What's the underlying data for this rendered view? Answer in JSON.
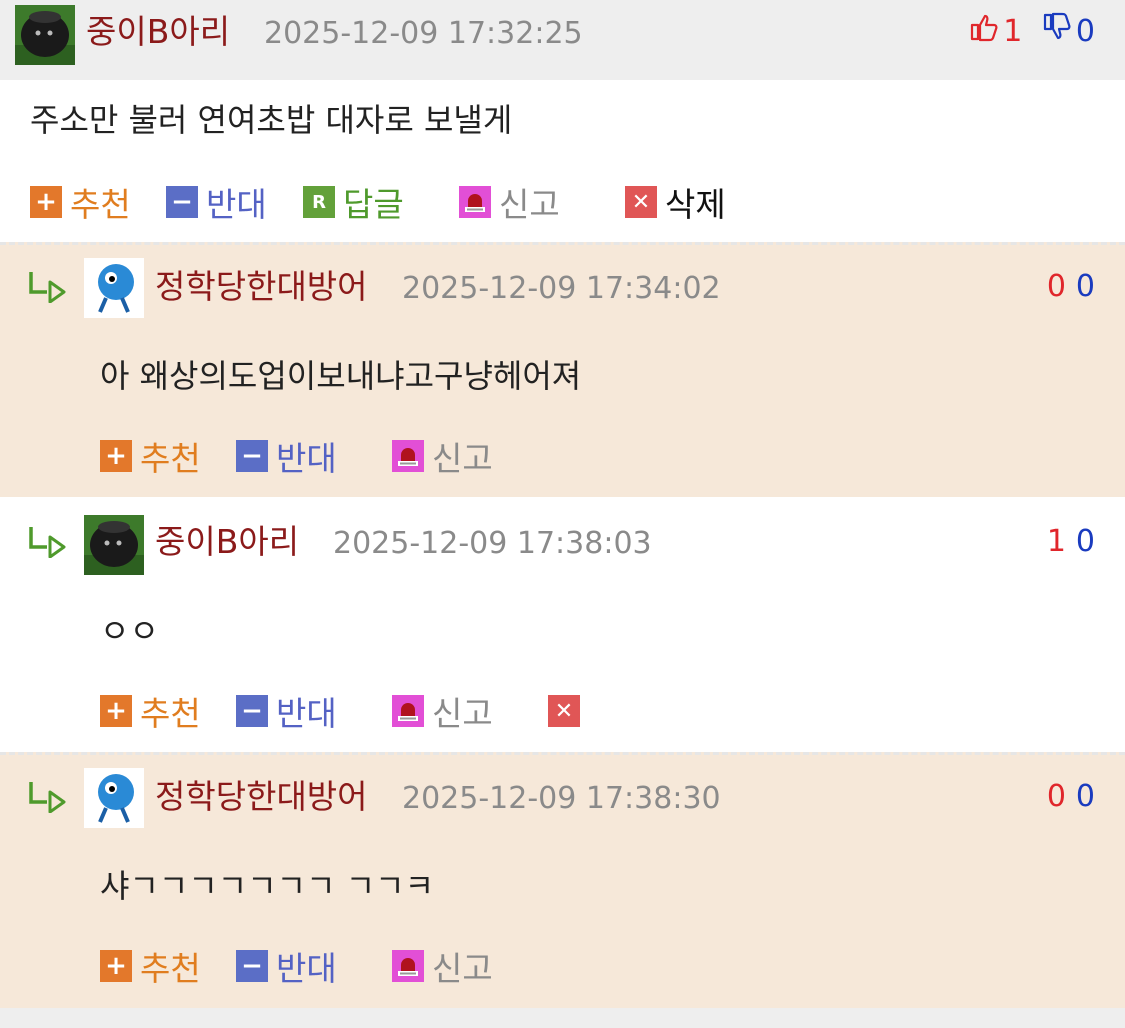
{
  "main_comment": {
    "author": "중이B아리",
    "time": "2025-12-09 17:32:25",
    "upvotes": "1",
    "downvotes": "0",
    "text": "주소만 불러 연여초밥 대자로 보낼게",
    "actions": {
      "recommend": "추천",
      "oppose": "반대",
      "reply": "답글",
      "report": "신고",
      "delete": "삭제"
    }
  },
  "replies": [
    {
      "author": "정학당한대방어",
      "time": "2025-12-09 17:34:02",
      "upvotes": "0",
      "downvotes": "0",
      "text": "아 왜상의도업이보내냐고구냥헤어져",
      "actions": {
        "recommend": "추천",
        "oppose": "반대",
        "report": "신고"
      }
    },
    {
      "author": "중이B아리",
      "time": "2025-12-09 17:38:03",
      "upvotes": "1",
      "downvotes": "0",
      "text": "ㅇㅇ",
      "actions": {
        "recommend": "추천",
        "oppose": "반대",
        "report": "신고"
      }
    },
    {
      "author": "정학당한대방어",
      "time": "2025-12-09 17:38:30",
      "upvotes": "0",
      "downvotes": "0",
      "text": "샤ㄱㄱㄱㄱㄱㄱㄱ ㄱㄱㅋ",
      "actions": {
        "recommend": "추천",
        "oppose": "반대",
        "report": "신고"
      }
    }
  ],
  "icons": {
    "thumbs_up": "thumbs-up-icon",
    "thumbs_down": "thumbs-down-icon",
    "recommend": "plus-icon",
    "oppose": "minus-icon",
    "reply": "reply-r-icon",
    "report": "siren-icon",
    "delete": "close-x-icon",
    "reply_arrow": "reply-arrow-icon"
  },
  "colors": {
    "author": "#8b1a1a",
    "upvote": "#e0262b",
    "downvote": "#1a3bbf",
    "recommend": "#e07d1f",
    "oppose": "#5462c4",
    "reply": "#4f9a2c",
    "peach_bg": "#f6e8d9",
    "header_bg": "#eeeeee"
  }
}
